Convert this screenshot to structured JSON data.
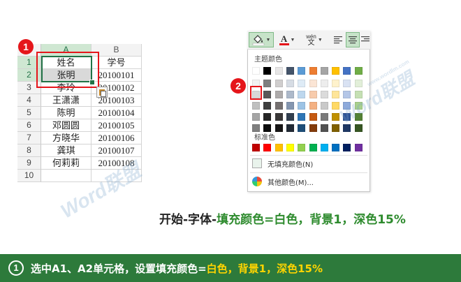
{
  "spreadsheet": {
    "columns": [
      "A",
      "B"
    ],
    "rows": [
      {
        "n": "1",
        "a": "姓名",
        "b": "学号"
      },
      {
        "n": "2",
        "a": "张明",
        "b": "20100101"
      },
      {
        "n": "3",
        "a": "李玲",
        "b": "20100102"
      },
      {
        "n": "4",
        "a": "王潇潇",
        "b": "20100103"
      },
      {
        "n": "5",
        "a": "陈明",
        "b": "20100104"
      },
      {
        "n": "6",
        "a": "邓圆圆",
        "b": "20100105"
      },
      {
        "n": "7",
        "a": "方晓华",
        "b": "20100106"
      },
      {
        "n": "8",
        "a": "龚琪",
        "b": "20100107"
      },
      {
        "n": "9",
        "a": "何莉莉",
        "b": "20100108"
      },
      {
        "n": "10",
        "a": "",
        "b": ""
      }
    ]
  },
  "steps": {
    "one": "1",
    "two": "2"
  },
  "toolbar": {
    "phonetic_top": "wén",
    "phonetic_bottom": "文",
    "font_color_letter": "A"
  },
  "palette": {
    "theme_title": "主题颜色",
    "standard_title": "标准色",
    "no_fill_label": "无填充颜色(N)",
    "more_colors_label": "其他颜色(M)...",
    "theme_colors": [
      [
        "#ffffff",
        "#000000",
        "#e7e6e6",
        "#44546a",
        "#5b9bd5",
        "#ed7d31",
        "#a5a5a5",
        "#ffc000",
        "#4472c4",
        "#70ad47"
      ],
      [
        "#f2f2f2",
        "#7f7f7f",
        "#d0cece",
        "#d6dce4",
        "#deebf6",
        "#fbe5d5",
        "#ededed",
        "#fff2cc",
        "#d9e2f3",
        "#e2efd9"
      ],
      [
        "#d8d8d8",
        "#595959",
        "#aeabab",
        "#adb9ca",
        "#bdd7ee",
        "#f7cbac",
        "#dbdbdb",
        "#fee599",
        "#b4c6e7",
        "#c5e0b3"
      ],
      [
        "#bfbfbf",
        "#3f3f3f",
        "#757070",
        "#8496b0",
        "#9cc3e5",
        "#f4b183",
        "#c9c9c9",
        "#ffd965",
        "#8eaadb",
        "#a8d08d"
      ],
      [
        "#a5a5a5",
        "#262626",
        "#3a3838",
        "#323f4f",
        "#2e75b5",
        "#c55a11",
        "#7b7b7b",
        "#bf9000",
        "#2f5496",
        "#538135"
      ],
      [
        "#7f7f7f",
        "#0c0c0c",
        "#171616",
        "#222a35",
        "#1e4e79",
        "#833c0b",
        "#525252",
        "#7f6000",
        "#1f3864",
        "#375623"
      ]
    ],
    "standard_colors": [
      "#c00000",
      "#ff0000",
      "#ffc000",
      "#ffff00",
      "#92d050",
      "#00b050",
      "#00b0f0",
      "#0070c0",
      "#002060",
      "#7030a0"
    ],
    "selected_color": "#d0cece"
  },
  "watermarks": {
    "left": "Word联盟",
    "right": "Word联盟",
    "right_url": "www.wordlm.com"
  },
  "caption": {
    "prefix": "开始-字体-",
    "highlight": "填充颜色=白色，背景1，深色15%"
  },
  "footer": {
    "number": "1",
    "text_prefix": "选中A1、A2单元格，设置填充颜色=",
    "text_highlight": "白色，背景1，深色15%"
  }
}
